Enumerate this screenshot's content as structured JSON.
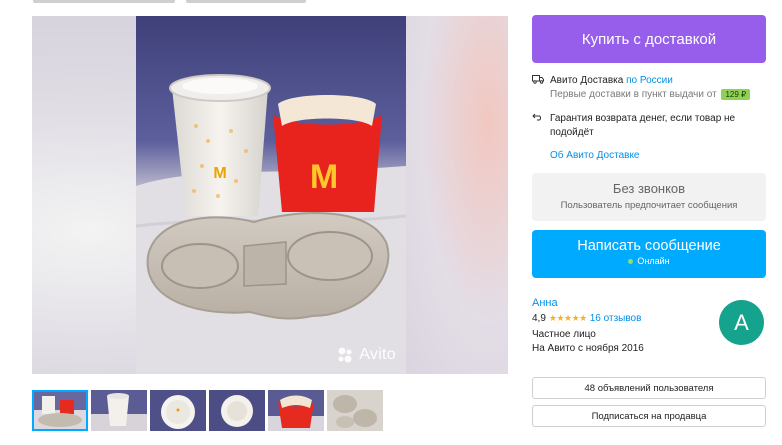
{
  "colors": {
    "buy_button": "#965eeb",
    "message_button": "#00aaff",
    "link": "#0091ea",
    "price_badge": "#8ed156",
    "avatar": "#16a38e",
    "online_dot": "#8be26b",
    "star": "#f5b22b"
  },
  "photo": {
    "watermark": "Avito",
    "thumbnails_count": 6,
    "active_thumbnail": 1
  },
  "purchase": {
    "buy_label": "Купить с доставкой"
  },
  "delivery": {
    "service": "Авито Доставка",
    "region": "по России",
    "first_delivery_text": "Первые доставки в пункт выдачи от",
    "price": "129 ₽",
    "guarantee": "Гарантия возврата денег, если товар не подойдёт",
    "about_link": "Об Авито Доставке"
  },
  "contact": {
    "no_calls_title": "Без звонков",
    "no_calls_subtitle": "Пользователь предпочитает сообщения",
    "message_label": "Написать сообщение",
    "online_status": "Онлайн"
  },
  "seller": {
    "name": "Анна",
    "rating": "4,9",
    "stars": "★★★★★",
    "reviews": "16 отзывов",
    "type": "Частное лицо",
    "since": "На Авито с ноября 2016",
    "avatar_letter": "A"
  },
  "actions": {
    "listings_button": "48 объявлений пользователя",
    "subscribe_button": "Подписаться на продавца"
  },
  "icons": {
    "delivery": "truck-icon",
    "guarantee": "return-arrow-icon",
    "watermark": "avito-logo-icon"
  }
}
